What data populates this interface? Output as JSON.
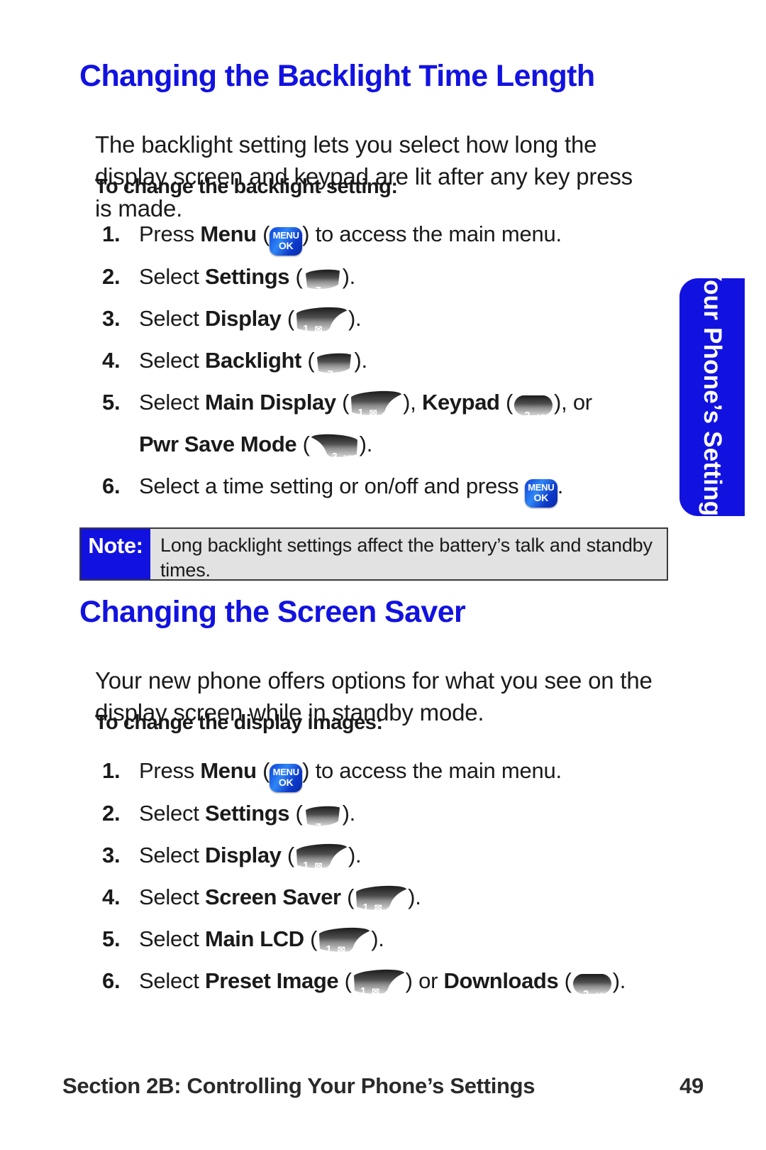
{
  "page": {
    "number": "49",
    "footer_section": "Section 2B: Controlling Your Phone’s Settings"
  },
  "side_tab": {
    "label": "Your Phone’s Settings",
    "color": "#1212e0"
  },
  "colors": {
    "heading_blue": "#1212e0",
    "note_label_bg": "#1212e0",
    "note_body_bg": "#e2e2e2",
    "key_grey": "#555555",
    "key_menu_blue": "#1f6fe8",
    "text": "#1a1a1a"
  },
  "sections": [
    {
      "title": "Changing the Backlight Time Length",
      "paragraph": "The backlight setting lets you select how long the display screen and keypad are lit after any key press is made.",
      "sub_head": "To change the backlight setting:",
      "steps": [
        {
          "num": "1.",
          "pre": "Press ",
          "bold": "Menu",
          "mid": " (",
          "key": "menu-ok",
          "post": ") to access the main menu."
        },
        {
          "num": "2.",
          "pre": "Select ",
          "bold": "Settings",
          "mid": " (",
          "key": "7pqrs",
          "post": ")."
        },
        {
          "num": "3.",
          "pre": "Select ",
          "bold": "Display",
          "mid": " (",
          "key": "1-envelope",
          "post": ")."
        },
        {
          "num": "4.",
          "pre": "Select ",
          "bold": "Backlight",
          "mid": " (",
          "key": "7pqrs",
          "post": ")."
        },
        {
          "num": "5.",
          "pre": "Select ",
          "bold": "Main Display",
          "mid": " (",
          "key": "1-envelope",
          "post": "), ",
          "bold2": "Keypad",
          "mid2": " (",
          "key2": "2abc",
          "post2": "), or",
          "line2_bold": "Pwr Save Mode",
          "line2_mid": " (",
          "line2_key": "3def",
          "line2_post": ")."
        },
        {
          "num": "6.",
          "pre": "Select a time setting or on/off and press ",
          "key": "menu-ok",
          "post": "."
        }
      ],
      "note": {
        "label": "Note:",
        "text": "Long backlight settings affect the battery’s talk and standby times."
      }
    },
    {
      "title": "Changing the Screen Saver",
      "paragraph": "Your new phone offers options for what you see on the display screen while in standby mode.",
      "sub_head": "To change the display images:",
      "steps": [
        {
          "num": "1.",
          "pre": "Press ",
          "bold": "Menu",
          "mid": " (",
          "key": "menu-ok",
          "post": ") to access the main menu."
        },
        {
          "num": "2.",
          "pre": "Select ",
          "bold": "Settings",
          "mid": " (",
          "key": "7pqrs",
          "post": ")."
        },
        {
          "num": "3.",
          "pre": "Select ",
          "bold": "Display",
          "mid": " (",
          "key": "1-envelope",
          "post": ")."
        },
        {
          "num": "4.",
          "pre": "Select ",
          "bold": "Screen Saver",
          "mid": " (",
          "key": "1-envelope",
          "post": ")."
        },
        {
          "num": "5.",
          "pre": "Select ",
          "bold": "Main LCD",
          "mid": " (",
          "key": "1-envelope",
          "post": ")."
        },
        {
          "num": "6.",
          "pre": "Select ",
          "bold": "Preset Image",
          "mid": " (",
          "key": "1-envelope",
          "post": ") or ",
          "bold2": "Downloads",
          "mid2": " (",
          "key2": "2abc",
          "post2": ")."
        }
      ]
    }
  ],
  "keys": {
    "menu-ok": {
      "line1": "MENU",
      "line2": "OK"
    },
    "7pqrs": {
      "digit": "7",
      "letters": "PQRS"
    },
    "2abc": {
      "digit": "2",
      "letters": "ABC"
    },
    "3def": {
      "digit": "3",
      "letters": "DEF"
    },
    "1-envelope": {
      "digit": "1",
      "letters": "✉"
    }
  }
}
